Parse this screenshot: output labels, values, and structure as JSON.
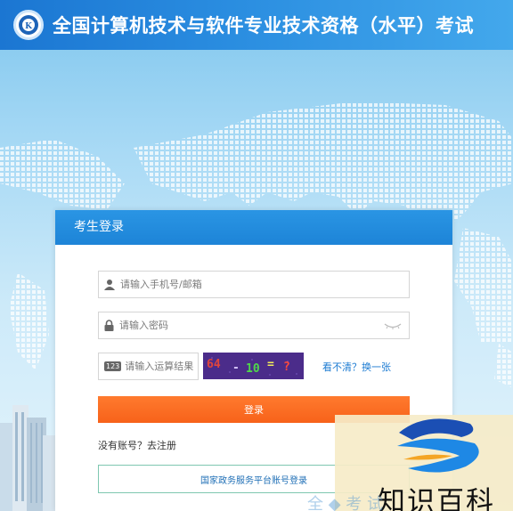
{
  "header": {
    "title": "全国计算机技术与软件专业技术资格（水平）考试",
    "logo_icon": "exam-emblem-icon"
  },
  "login": {
    "panel_title": "考生登录",
    "username_placeholder": "请输入手机号/邮箱",
    "password_placeholder": "请输入密码",
    "captcha_placeholder": "请输入运算结果",
    "captcha_badge": "123",
    "captcha_text": [
      "64",
      "-",
      "10",
      "=",
      "?"
    ],
    "refresh_link": "看不清？换一张",
    "submit_label": "登录",
    "register_link": "没有账号？去注册",
    "gov_login_label": "国家政务服务平台账号登录"
  },
  "watermark": {
    "text": "知识百科",
    "faint_text": "全 ◆ 考 试"
  },
  "colors": {
    "header": "#1b76d2",
    "panel_head": "#1d84d7",
    "login_button": "#f7621a",
    "link": "#1c7bd2"
  }
}
